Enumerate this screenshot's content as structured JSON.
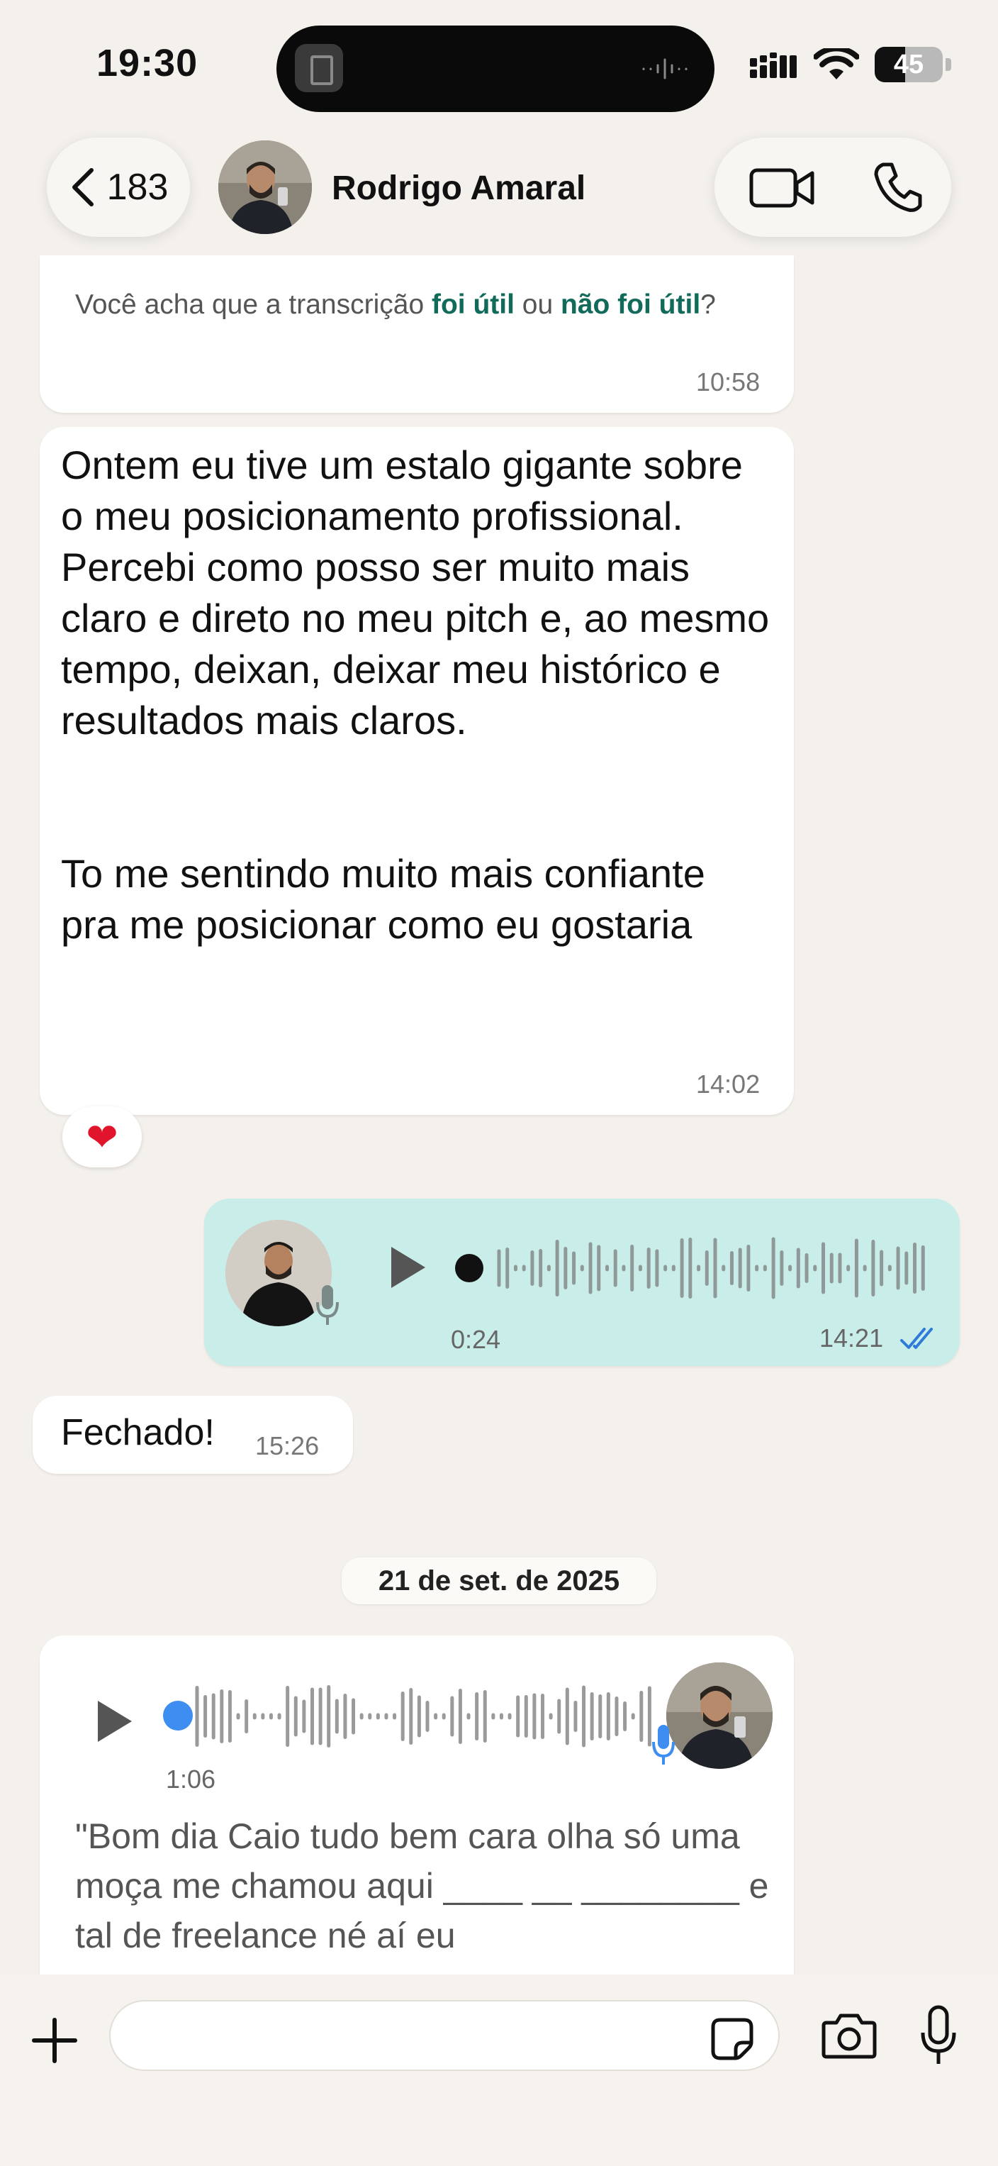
{
  "status_bar": {
    "time": "19:30",
    "battery_percent": "45",
    "battery_level": 0.45,
    "icons": [
      "signal-icon",
      "wifi-icon",
      "battery-icon"
    ]
  },
  "header": {
    "back_count": "183",
    "contact_name": "Rodrigo Amaral",
    "actions": [
      "video-call-icon",
      "phone-icon"
    ]
  },
  "messages": {
    "transcription_feedback": {
      "prefix": "Você acha que a transcrição ",
      "useful": "foi útil",
      "middle": " ou ",
      "not_useful": "não foi útil",
      "suffix": "?",
      "time": "10:58"
    },
    "long_text": {
      "text": "Ontem eu tive um estalo gigante sobre o meu posicionamento profissional. Percebi como posso ser muito mais claro e direto no meu pitch e, ao mesmo tempo, deixan, deixar meu histórico e resultados mais claros.\n\n\nTo me sentindo muito mais confiante pra me posicionar como eu gostaria",
      "time": "14:02",
      "reaction": "❤"
    },
    "voice_outgoing": {
      "duration": "0:24",
      "time": "14:21",
      "read_status": "read-checkmarks-icon"
    },
    "short_text": {
      "text": "Fechado!",
      "time": "15:26"
    },
    "date_separator": "21 de set. de 2025",
    "voice_incoming": {
      "duration": "1:06",
      "transcript": "\"Bom dia Caio tudo bem cara olha só uma moça me chamou aqui ____ __ ________ e tal de freelance né aí eu"
    }
  },
  "composer": {
    "placeholder": "",
    "icons": [
      "plus-icon",
      "sticker-icon",
      "camera-icon",
      "microphone-icon"
    ]
  },
  "colors": {
    "background": "#f4f1ec",
    "outgoing_bubble": "#c9ede9",
    "incoming_bubble": "#ffffff",
    "link_accent": "#126b5a",
    "read_ticks": "#2f7bd8",
    "playback_dot_incoming": "#3d8ef0",
    "reaction_heart": "#e0152b"
  }
}
